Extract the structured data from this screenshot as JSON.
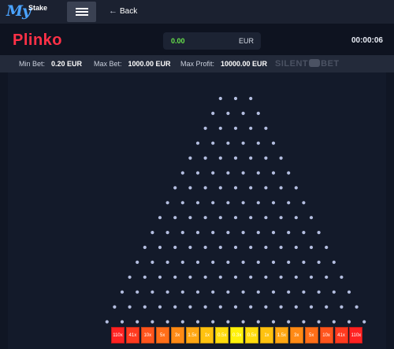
{
  "header": {
    "logo_script": "My",
    "logo_word": "Stake",
    "back_label": "Back"
  },
  "game": {
    "title": "Plinko",
    "balance_value": "0.00",
    "balance_currency": "EUR",
    "timer": "00:00:06"
  },
  "limits": {
    "min_bet_label": "Min Bet:",
    "min_bet_value": "0.20 EUR",
    "max_bet_label": "Max Bet:",
    "max_bet_value": "1000.00 EUR",
    "max_profit_label": "Max Profit:",
    "max_profit_value": "10000.00 EUR"
  },
  "watermark": {
    "left": "SILENT",
    "right": "BET"
  },
  "board": {
    "peg_color": "#b4bee0",
    "first_row_pegs": 3,
    "row_count": 16,
    "multipliers": [
      "110x",
      "41x",
      "10x",
      "5x",
      "3x",
      "1.5x",
      "1x",
      "0.5x",
      "0.3x",
      "0.5x",
      "1x",
      "1.5x",
      "3x",
      "5x",
      "10x",
      "41x",
      "110x"
    ],
    "slot_colors": [
      "#ff2222",
      "#ff3a1f",
      "#ff541c",
      "#ff6e18",
      "#ff8a15",
      "#ffa612",
      "#ffc20f",
      "#ffdb0c",
      "#fff20a",
      "#ffdb0c",
      "#ffc20f",
      "#ffa612",
      "#ff8a15",
      "#ff6e18",
      "#ff541c",
      "#ff3a1f",
      "#ff2222"
    ]
  }
}
